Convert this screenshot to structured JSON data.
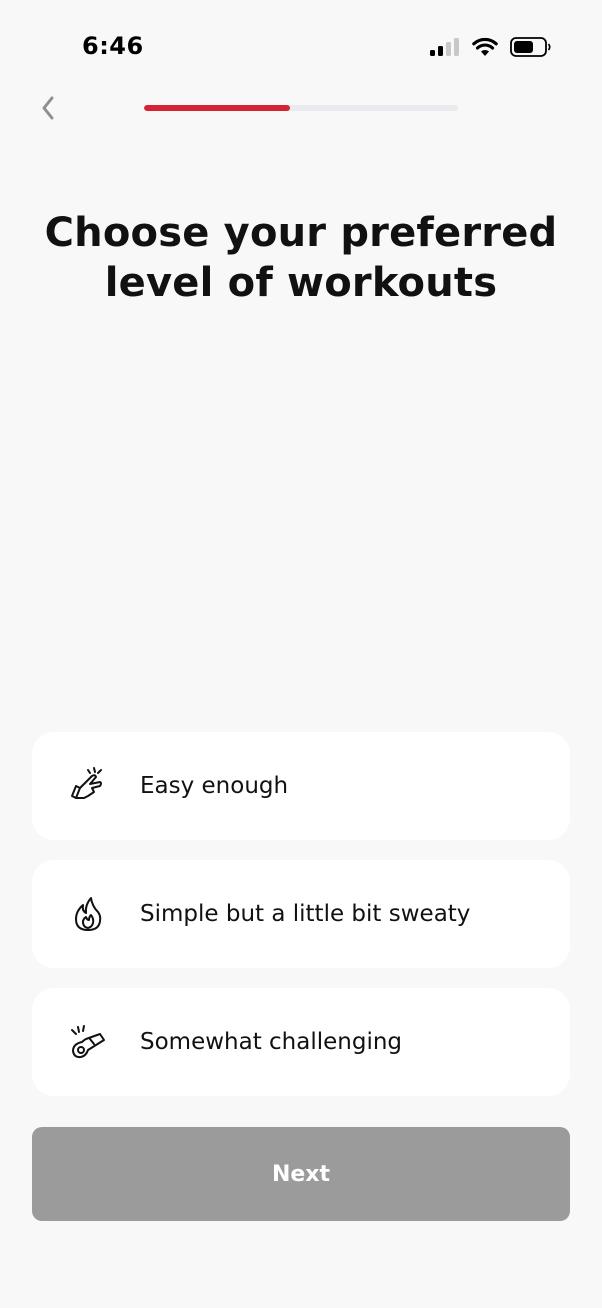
{
  "status_bar": {
    "time": "6:46",
    "icons": [
      "cellular-signal-icon",
      "wifi-icon",
      "battery-icon"
    ]
  },
  "header": {
    "back_icon": "chevron-left-icon",
    "progress_fraction": 0.465,
    "progress_color": "#d52336",
    "track_color": "#ebebef"
  },
  "main": {
    "title": "Choose your preferred level of workouts",
    "options": [
      {
        "icon": "pointing-hand-icon",
        "label": "Easy enough"
      },
      {
        "icon": "flame-icon",
        "label": "Simple but a little bit sweaty"
      },
      {
        "icon": "whistle-icon",
        "label": "Somewhat challenging"
      }
    ]
  },
  "footer": {
    "next_label": "Next",
    "next_bg": "#9b9b9b"
  }
}
